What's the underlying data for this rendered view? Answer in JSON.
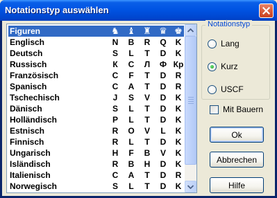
{
  "window": {
    "title": "Notationstyp auswählen",
    "close_icon": "close-icon"
  },
  "list": {
    "header": {
      "label": "Figuren",
      "piece_icons": [
        "knight-icon",
        "bishop-icon",
        "rook-icon",
        "queen-icon",
        "king-icon"
      ]
    },
    "rows": [
      {
        "language": "Englisch",
        "letters": [
          "N",
          "B",
          "R",
          "Q",
          "K"
        ]
      },
      {
        "language": "Deutsch",
        "letters": [
          "S",
          "L",
          "T",
          "D",
          "K"
        ]
      },
      {
        "language": "Russisch",
        "letters": [
          "К",
          "С",
          "Л",
          "Ф",
          "Кр"
        ]
      },
      {
        "language": "Französisch",
        "letters": [
          "C",
          "F",
          "T",
          "D",
          "R"
        ]
      },
      {
        "language": "Spanisch",
        "letters": [
          "C",
          "A",
          "T",
          "D",
          "R"
        ]
      },
      {
        "language": "Tschechisch",
        "letters": [
          "J",
          "S",
          "V",
          "D",
          "K"
        ]
      },
      {
        "language": "Dänisch",
        "letters": [
          "S",
          "L",
          "T",
          "D",
          "K"
        ]
      },
      {
        "language": "Holländisch",
        "letters": [
          "P",
          "L",
          "T",
          "D",
          "K"
        ]
      },
      {
        "language": "Estnisch",
        "letters": [
          "R",
          "O",
          "V",
          "L",
          "K"
        ]
      },
      {
        "language": "Finnisch",
        "letters": [
          "R",
          "L",
          "T",
          "D",
          "K"
        ]
      },
      {
        "language": "Ungarisch",
        "letters": [
          "H",
          "F",
          "B",
          "V",
          "K"
        ]
      },
      {
        "language": "Isländisch",
        "letters": [
          "R",
          "B",
          "H",
          "D",
          "K"
        ]
      },
      {
        "language": "Italienisch",
        "letters": [
          "C",
          "A",
          "T",
          "D",
          "R"
        ]
      },
      {
        "language": "Norwegisch",
        "letters": [
          "S",
          "L",
          "T",
          "D",
          "K"
        ]
      }
    ]
  },
  "notation_group": {
    "label": "Notationstyp",
    "options": [
      {
        "label": "Lang",
        "selected": false
      },
      {
        "label": "Kurz",
        "selected": true
      },
      {
        "label": "USCF",
        "selected": false
      }
    ]
  },
  "mit_bauern": {
    "label": "Mit Bauern",
    "checked": false
  },
  "buttons": {
    "ok": "Ok",
    "abbrechen": "Abbrechen",
    "hilfe": "Hilfe"
  },
  "colors": {
    "selection": "#316ac5",
    "titlebar": "#0054e3",
    "group_label": "#0046d5"
  }
}
